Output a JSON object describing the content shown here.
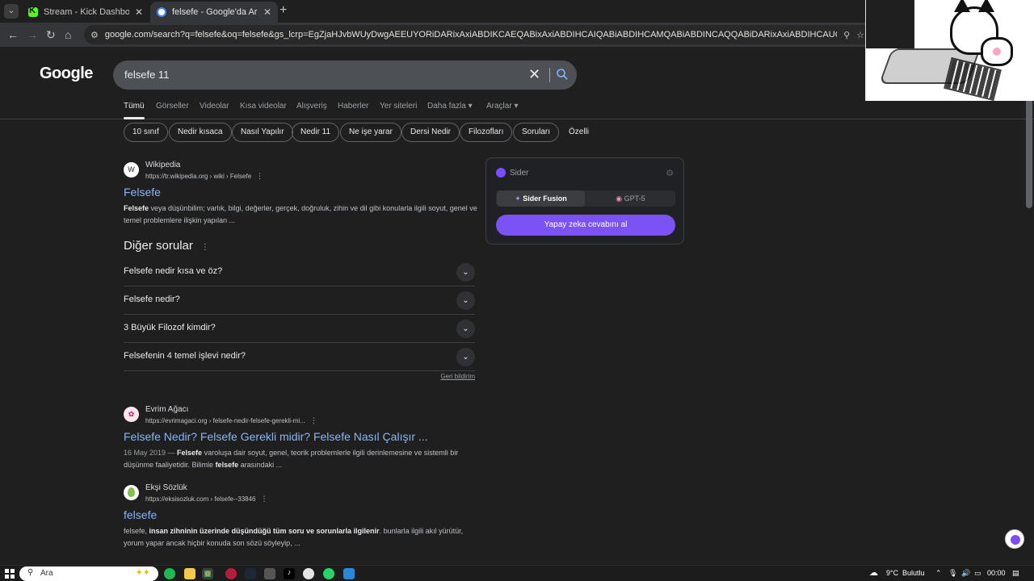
{
  "browser": {
    "tabs": [
      {
        "title": "Stream - Kick Dashboard",
        "active": false
      },
      {
        "title": "felsefe - Google'da Ara",
        "active": true
      }
    ],
    "url": "google.com/search?q=felsefe&oq=felsefe&gs_lcrp=EgZjaHJvbWUyDwgAEEUYORiDARixAxiABDIKCAEQABixAxiABDIHCAIQABiABDIHCAMQABiABDINCAQQABiDARixAxiABDIHCAUQABiABDIGCAYQRRg9MgYIBxBFGD2S..."
  },
  "google": {
    "logo": "Google",
    "query": "felsefe 11",
    "tabs": [
      "Tümü",
      "Görseller",
      "Videolar",
      "Kısa videolar",
      "Alışveriş",
      "Haberler",
      "Yer siteleri",
      "Daha fazla",
      "Araçlar"
    ],
    "chips": [
      "10 sınıf",
      "Nedir kısaca",
      "Nasıl Yapılır",
      "Nedir 11",
      "Ne işe yarar",
      "Dersi Nedir",
      "Filozofları",
      "Soruları",
      "Özelli"
    ],
    "results": [
      {
        "site": "Wikipedia",
        "cite": "https://tr.wikipedia.org › wiki › Felsefe",
        "title": "Felsefe",
        "snippet_bold": "Felsefe",
        "snippet_rest": " veya düşünbilim; varlık, bilgi, değerler, gerçek, doğruluk, zihin ve dil gibi konularla ilgili soyut, genel ve temel problemlere ilişkin yapılan ..."
      },
      {
        "site": "Evrim Ağacı",
        "cite": "https://evrimagaci.org › felsefe-nedir-felsefe-gerekli-mi...",
        "title": "Felsefe Nedir? Felsefe Gerekli midir? Felsefe Nasıl Çalışır ...",
        "snippet_date": "16 May 2019 — ",
        "snippet_bold": "Felsefe",
        "snippet_mid": " varoluşa dair soyut, genel, teorik problemlerle ilgili derinlemesine ve sistemli bir düşünme faaliyetidir. Bilimle ",
        "snippet_bold2": "felsefe",
        "snippet_rest": " arasındaki ..."
      },
      {
        "site": "Ekşi Sözlük",
        "cite": "https://eksisozluk.com › felsefe--33846",
        "title": "felsefe",
        "snippet_start": "felsefe, ",
        "snippet_bold": "insan zihninin üzerinde düşündüğü tüm soru ve sorunlarla ilgilenir",
        "snippet_rest": ". bunlarla ilgili akıl yürütür, yorum yapar ancak hiçbir konuda son sözü söyleyip, ..."
      }
    ],
    "paa": {
      "heading": "Diğer sorular",
      "questions": [
        "Felsefe nedir kısa ve öz?",
        "Felsefe nedir?",
        "3 Büyük Filozof kimdir?",
        "Felsefenin 4 temel işlevi nedir?"
      ],
      "feedback": "Geri bildirim"
    }
  },
  "sider": {
    "name": "Sider",
    "options": [
      "Sider Fusion",
      "GPT-5"
    ],
    "button": "Yapay zeka cevabını al"
  },
  "taskbar": {
    "search_label": "Ara",
    "weather": "9°C",
    "weather_desc": "Bulutlu",
    "clock": "00:00"
  },
  "colors": {
    "link": "#8ab4f8",
    "sider_accent": "#7b52f4",
    "background": "#1f1f1f"
  }
}
